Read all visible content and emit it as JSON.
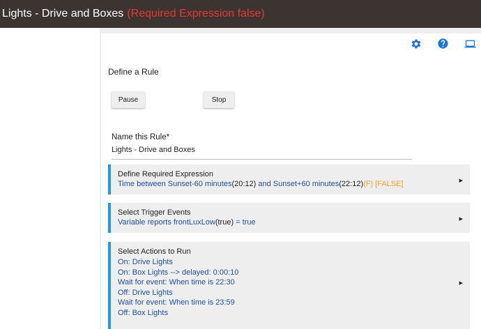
{
  "titlebar": {
    "title": "Lights - Drive and Boxes",
    "status": "(Required Expression false)"
  },
  "header_icons": [
    "gear-icon",
    "help-icon",
    "laptop-icon"
  ],
  "page": {
    "heading": "Define a Rule"
  },
  "buttons": {
    "pause": "Pause",
    "stop": "Stop"
  },
  "name_field": {
    "label": "Name this Rule*",
    "value": "Lights - Drive and Boxes"
  },
  "required_expression": {
    "title": "Define Required Expression",
    "part1": "Time between Sunset-60 minutes",
    "time1": "(20:12)",
    "part2": " and Sunset+60 minutes",
    "time2": "(22:12)",
    "flag": "(F)",
    "result": " [FALSE]"
  },
  "trigger_events": {
    "title": "Select Trigger Events",
    "part1": "Variable reports frontLuxLow",
    "state": "(true)",
    "part2": " = true"
  },
  "actions": {
    "title": "Select Actions to Run",
    "items": [
      "On: Drive Lights",
      "On: Box Lights --> delayed: 0:00:10",
      "Wait for event: When time is 22:30",
      "Off: Drive Lights",
      "Wait for event: When time is 23:59",
      "Off: Box Lights"
    ]
  },
  "expand_arrow": "▶",
  "colors": {
    "titlebar_bg": "#3b3431",
    "title_error": "#e53935",
    "accent_blue": "#2196f3",
    "link_text": "#1e50a0",
    "warning_orange": "#f0a030",
    "icon_blue": "#1976d2"
  }
}
